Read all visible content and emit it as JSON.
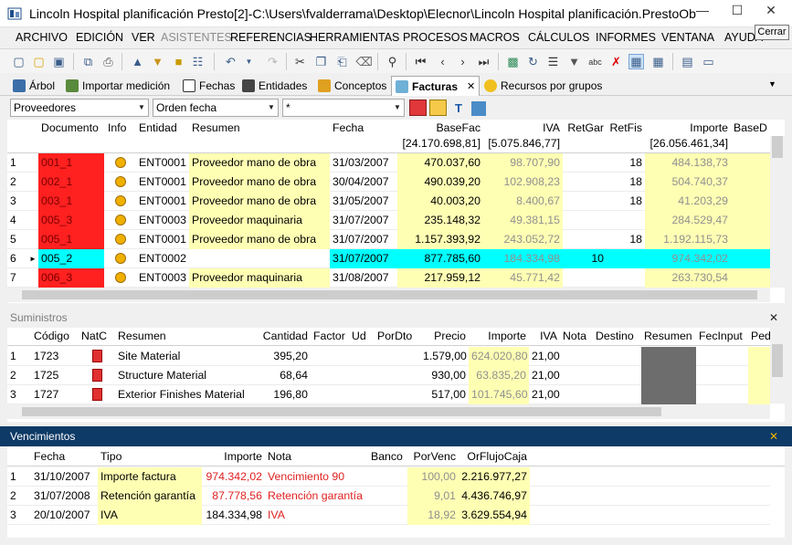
{
  "window": {
    "title": "Lincoln Hospital planificación Presto[2]-C:\\Users\\fvalderrama\\Desktop\\Elecnor\\Lincoln Hospital planificación.PrestoOb...",
    "close_tooltip": "Cerrar",
    "minimize": "—",
    "maximize": "☐",
    "close": "✕"
  },
  "menu": [
    {
      "label": "ARCHIVO",
      "disabled": false
    },
    {
      "label": "EDICIÓN",
      "disabled": false
    },
    {
      "label": "VER",
      "disabled": false
    },
    {
      "label": "ASISTENTES",
      "disabled": true
    },
    {
      "label": "REFERENCIAS",
      "disabled": false
    },
    {
      "label": "HERRAMIENTAS",
      "disabled": false
    },
    {
      "label": "PROCESOS",
      "disabled": false
    },
    {
      "label": "MACROS",
      "disabled": false
    },
    {
      "label": "CÁLCULOS",
      "disabled": false
    },
    {
      "label": "INFORMES",
      "disabled": false
    },
    {
      "label": "VENTANA",
      "disabled": false
    },
    {
      "label": "AYUDA",
      "disabled": false
    }
  ],
  "tabs": [
    {
      "label": "Árbol",
      "icon": "tree-icon"
    },
    {
      "label": "Importar medición",
      "icon": "import-icon"
    },
    {
      "label": "Fechas",
      "icon": "calendar-icon"
    },
    {
      "label": "Entidades",
      "icon": "entities-icon"
    },
    {
      "label": "Conceptos",
      "icon": "concepts-icon"
    },
    {
      "label": "Facturas",
      "icon": "invoices-icon"
    },
    {
      "label": "Recursos por grupos",
      "icon": "resources-icon"
    }
  ],
  "tab_close": "✕",
  "filters": {
    "entity": "Proveedores",
    "order": "Orden fecha",
    "search": "*"
  },
  "invoices": {
    "headers": {
      "doc": "Documento",
      "info": "Info",
      "entity": "Entidad",
      "summary": "Resumen",
      "date": "Fecha",
      "basefac": "BaseFac",
      "iva": "IVA",
      "retgar": "RetGar",
      "retfis": "RetFis",
      "importe": "Importe",
      "based": "BaseD"
    },
    "totals": {
      "basefac": "[24.170.698,81]",
      "iva": "[5.075.846,77]",
      "importe": "[26.056.461,34]"
    },
    "rows": [
      {
        "n": "1",
        "doc": "001_1",
        "entity": "ENT0001",
        "summary": "Proveedor mano de obra",
        "date": "31/03/2007",
        "basefac": "470.037,60",
        "iva": "98.707,90",
        "retgar": "",
        "retfis": "18",
        "importe": "484.138,73"
      },
      {
        "n": "2",
        "doc": "002_1",
        "entity": "ENT0001",
        "summary": "Proveedor mano de obra",
        "date": "30/04/2007",
        "basefac": "490.039,20",
        "iva": "102.908,23",
        "retgar": "",
        "retfis": "18",
        "importe": "504.740,37"
      },
      {
        "n": "3",
        "doc": "003_1",
        "entity": "ENT0001",
        "summary": "Proveedor mano de obra",
        "date": "31/05/2007",
        "basefac": "40.003,20",
        "iva": "8.400,67",
        "retgar": "",
        "retfis": "18",
        "importe": "41.203,29"
      },
      {
        "n": "4",
        "doc": "005_3",
        "entity": "ENT0003",
        "summary": "Proveedor maquinaria",
        "date": "31/07/2007",
        "basefac": "235.148,32",
        "iva": "49.381,15",
        "retgar": "",
        "retfis": "",
        "importe": "284.529,47"
      },
      {
        "n": "5",
        "doc": "005_1",
        "entity": "ENT0001",
        "summary": "Proveedor mano de obra",
        "date": "31/07/2007",
        "basefac": "1.157.393,92",
        "iva": "243.052,72",
        "retgar": "",
        "retfis": "18",
        "importe": "1.192.115,73"
      },
      {
        "n": "6",
        "doc": "005_2",
        "entity": "ENT0002",
        "summary": "",
        "date": "31/07/2007",
        "basefac": "877.785,60",
        "iva": "184.334,98",
        "retgar": "10",
        "retfis": "",
        "importe": "974.342,02"
      },
      {
        "n": "7",
        "doc": "006_3",
        "entity": "ENT0003",
        "summary": "Proveedor maquinaria",
        "date": "31/08/2007",
        "basefac": "217.959,12",
        "iva": "45.771,42",
        "retgar": "",
        "retfis": "",
        "importe": "263.730,54"
      }
    ]
  },
  "supplies": {
    "title": "Suministros",
    "headers": {
      "code": "Código",
      "natc": "NatC",
      "summary": "Resumen",
      "qty": "Cantidad",
      "factor": "Factor",
      "ud": "Ud",
      "pordto": "PorDto",
      "price": "Precio",
      "importe": "Importe",
      "iva": "IVA",
      "nota": "Nota",
      "destino": "Destino",
      "resumen2": "Resumen",
      "fecinput": "FecInput",
      "ped": "Ped"
    },
    "rows": [
      {
        "n": "1",
        "code": "1723",
        "summary": "Site Material",
        "qty": "395,20",
        "price": "1.579,00",
        "importe": "624.020,80",
        "iva": "21,00"
      },
      {
        "n": "2",
        "code": "1725",
        "summary": "Structure Material",
        "qty": "68,64",
        "price": "930,00",
        "importe": "63.835,20",
        "iva": "21,00"
      },
      {
        "n": "3",
        "code": "1727",
        "summary": "Exterior Finishes Material",
        "qty": "196,80",
        "price": "517,00",
        "importe": "101.745,60",
        "iva": "21,00"
      }
    ]
  },
  "due": {
    "title": "Vencimientos",
    "headers": {
      "date": "Fecha",
      "type": "Tipo",
      "importe": "Importe",
      "nota": "Nota",
      "banco": "Banco",
      "porvenc": "PorVenc",
      "flujo": "OrFlujoCaja"
    },
    "rows": [
      {
        "n": "1",
        "date": "31/10/2007",
        "type": "Importe factura",
        "importe": "974.342,02",
        "nota": "Vencimiento 90",
        "porvenc": "100,00",
        "flujo": "2.216.977,27",
        "red": true
      },
      {
        "n": "2",
        "date": "31/07/2008",
        "type": "Retención garantía",
        "importe": "87.778,56",
        "nota": "Retención garantía",
        "porvenc": "9,01",
        "flujo": "4.436.746,97",
        "red": true
      },
      {
        "n": "3",
        "date": "20/10/2007",
        "type": "IVA",
        "importe": "184.334,98",
        "nota": "IVA",
        "porvenc": "18,92",
        "flujo": "3.629.554,94",
        "red": false
      }
    ]
  },
  "colors": {
    "accent": "#0d3a66",
    "doc_red": "#ff2020",
    "selected": "#00ffff",
    "yellow": "#ffffb4"
  }
}
